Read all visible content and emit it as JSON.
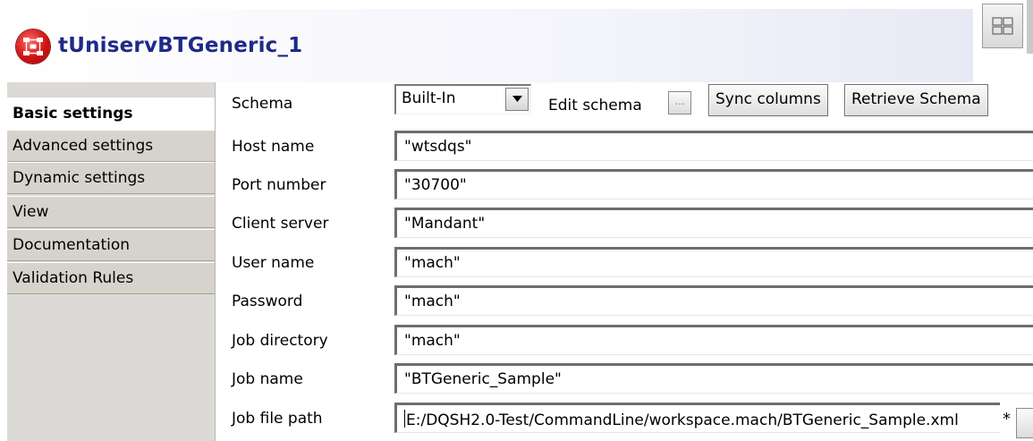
{
  "header": {
    "component_name": "tUniservBTGeneric_1",
    "icon": "component-icon",
    "layout_icon": "layout-toggle-icon"
  },
  "sidebar": {
    "tabs": [
      {
        "label": "Basic settings",
        "active": true
      },
      {
        "label": "Advanced settings",
        "active": false
      },
      {
        "label": "Dynamic settings",
        "active": false
      },
      {
        "label": "View",
        "active": false
      },
      {
        "label": "Documentation",
        "active": false
      },
      {
        "label": "Validation Rules",
        "active": false
      }
    ]
  },
  "form": {
    "schema": {
      "label": "Schema",
      "value": "Built-In",
      "edit_schema_label": "Edit schema",
      "edit_schema_button": "...",
      "sync_columns": "Sync columns",
      "retrieve_schema": "Retrieve Schema"
    },
    "host_name": {
      "label": "Host name",
      "value": "\"wtsdqs\""
    },
    "port_number": {
      "label": "Port number",
      "value": "\"30700\""
    },
    "client_server": {
      "label": "Client server",
      "value": "\"Mandant\""
    },
    "user_name": {
      "label": "User name",
      "value": "\"mach\""
    },
    "password": {
      "label": "Password",
      "value": "\"mach\""
    },
    "job_directory": {
      "label": "Job directory",
      "value": "\"mach\""
    },
    "job_name": {
      "label": "Job name",
      "value": "\"BTGeneric_Sample\""
    },
    "job_file_path": {
      "label": "Job file path",
      "value": "E:/DQSH2.0-Test/CommandLine/workspace.mach/BTGeneric_Sample.xml",
      "required_marker": "*"
    }
  }
}
